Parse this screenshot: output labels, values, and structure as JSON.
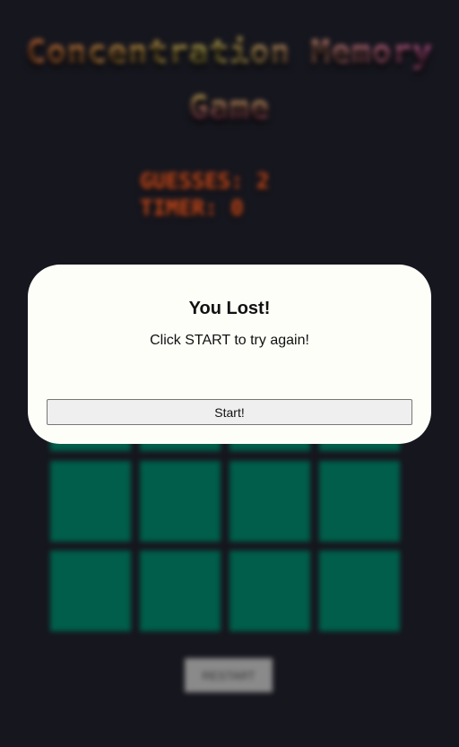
{
  "game": {
    "title_line1": "Concentration Memory",
    "title_line2": "Game",
    "guesses_label": "GUESSES: 2",
    "timer_label": "TIMER: 0",
    "restart_label": "RESTART"
  },
  "modal": {
    "title": "You Lost!",
    "message": "Click START to try again!",
    "start_label": "Start!"
  },
  "colors": {
    "background": "#16161e",
    "card": "#005e4a",
    "stats": "#c74a1c",
    "modal_bg": "#fefef9"
  }
}
